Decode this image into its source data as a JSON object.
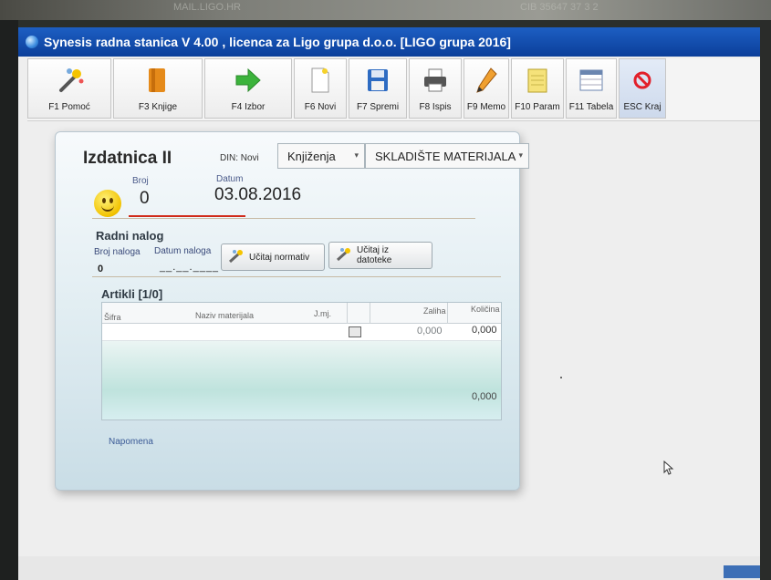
{
  "window": {
    "title": "Synesis radna stanica V 4.00 , licenca za Ligo grupa d.o.o.  [LIGO grupa 2016]"
  },
  "toolbar": {
    "buttons": [
      {
        "label": "F1 Pomoć",
        "icon": "magic-wand-icon"
      },
      {
        "label": "F3 Knjige",
        "icon": "book-icon"
      },
      {
        "label": "F4 Izbor",
        "icon": "arrow-right-icon"
      },
      {
        "label": "F6 Novi",
        "icon": "new-document-icon"
      },
      {
        "label": "F7 Spremi",
        "icon": "floppy-disk-icon"
      },
      {
        "label": "F8 Ispis",
        "icon": "printer-icon"
      },
      {
        "label": "F9 Memo",
        "icon": "pencil-icon"
      },
      {
        "label": "F10 Param",
        "icon": "notepad-icon"
      },
      {
        "label": "F11 Tabela",
        "icon": "table-icon"
      },
      {
        "label": "ESC Kraj",
        "icon": "stop-icon"
      }
    ]
  },
  "form": {
    "title": "Izdatnica II",
    "din_label": "DIN: Novi",
    "mode_select": "Knjiženja",
    "warehouse_select": "SKLADIŠTE MATERIJALA",
    "broj_label": "Broj",
    "broj_value": "0",
    "datum_label": "Datum",
    "datum_value": "03.08.2016"
  },
  "radni_nalog": {
    "title": "Radni nalog",
    "broj_naloga_label": "Broj naloga",
    "datum_naloga_label": "Datum naloga",
    "broj_naloga_value": "0",
    "datum_naloga_value": "__.__.____",
    "btn_normativ": "Učitaj normativ",
    "btn_datoteka": "Učitaj iz datoteke"
  },
  "artikli": {
    "title": "Artikli  [1/0]",
    "columns": [
      "Šifra",
      "Naziv materijala",
      "J.mj.",
      "Zaliha",
      "Količina"
    ],
    "row": {
      "zaliha": "0,000",
      "kolicina": "0,000"
    },
    "total": "0,000"
  },
  "napomena_label": "Napomena",
  "background": {
    "ghost_text_left": "MAIL.LIGO.HR",
    "ghost_text_right": "CIB 35647 37 3 2"
  }
}
